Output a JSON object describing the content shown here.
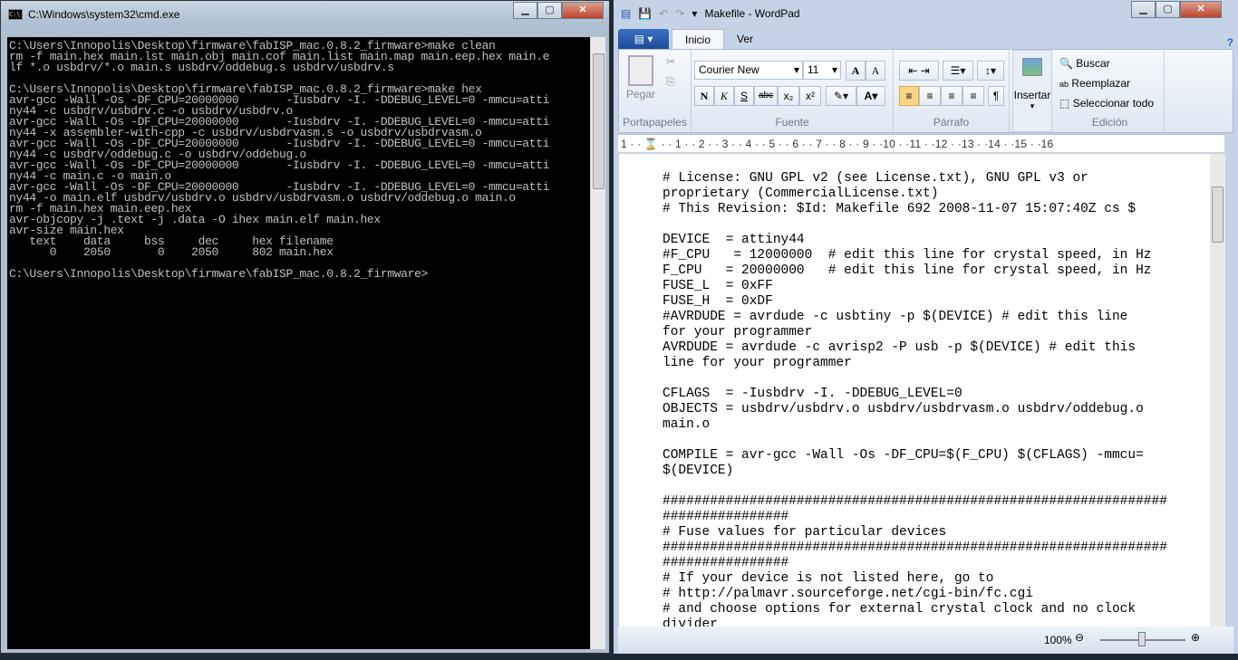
{
  "cmd": {
    "title": "C:\\Windows\\system32\\cmd.exe",
    "icon": "cmd-icon",
    "lines": [
      "C:\\Users\\Innopolis\\Desktop\\firmware\\fabISP_mac.0.8.2_firmware>make clean",
      "rm -f main.hex main.lst main.obj main.cof main.list main.map main.eep.hex main.e",
      "lf *.o usbdrv/*.o main.s usbdrv/oddebug.s usbdrv/usbdrv.s",
      "",
      "C:\\Users\\Innopolis\\Desktop\\firmware\\fabISP_mac.0.8.2_firmware>make hex",
      "avr-gcc -Wall -Os -DF_CPU=20000000       -Iusbdrv -I. -DDEBUG_LEVEL=0 -mmcu=atti",
      "ny44 -c usbdrv/usbdrv.c -o usbdrv/usbdrv.o",
      "avr-gcc -Wall -Os -DF_CPU=20000000       -Iusbdrv -I. -DDEBUG_LEVEL=0 -mmcu=atti",
      "ny44 -x assembler-with-cpp -c usbdrv/usbdrvasm.s -o usbdrv/usbdrvasm.o",
      "avr-gcc -Wall -Os -DF_CPU=20000000       -Iusbdrv -I. -DDEBUG_LEVEL=0 -mmcu=atti",
      "ny44 -c usbdrv/oddebug.c -o usbdrv/oddebug.o",
      "avr-gcc -Wall -Os -DF_CPU=20000000       -Iusbdrv -I. -DDEBUG_LEVEL=0 -mmcu=atti",
      "ny44 -c main.c -o main.o",
      "avr-gcc -Wall -Os -DF_CPU=20000000       -Iusbdrv -I. -DDEBUG_LEVEL=0 -mmcu=atti",
      "ny44 -o main.elf usbdrv/usbdrv.o usbdrv/usbdrvasm.o usbdrv/oddebug.o main.o",
      "rm -f main.hex main.eep.hex",
      "avr-objcopy -j .text -j .data -O ihex main.elf main.hex",
      "avr-size main.hex",
      "   text    data     bss     dec     hex filename",
      "      0    2050       0    2050     802 main.hex",
      "",
      "C:\\Users\\Innopolis\\Desktop\\firmware\\fabISP_mac.0.8.2_firmware>"
    ]
  },
  "wordpad": {
    "title": "Makefile - WordPad",
    "tabs": [
      "Inicio",
      "Ver"
    ],
    "font": "Courier New",
    "size": "11",
    "buttons": {
      "paste": "Pegar",
      "insert": "Insertar",
      "find": "Buscar",
      "replace": "Reemplazar",
      "select_all": "Seleccionar todo",
      "bold": "N",
      "italic": "K",
      "underline": "S",
      "strike": "abc"
    },
    "groups": [
      "Portapapeles",
      "Fuente",
      "Párrafo",
      "Edición"
    ],
    "ruler": "1 · · ⌛ · · 1 · · 2 · · 3 · · 4 · · 5 · · 6 · · 7 · · 8 · · 9 · ·10 · ·11 · ·12 · ·13 · ·14 · ·15 · ·16",
    "document": [
      "# License: GNU GPL v2 (see License.txt), GNU GPL v3 or",
      "proprietary (CommercialLicense.txt)",
      "# This Revision: $Id: Makefile 692 2008-11-07 15:07:40Z cs $",
      "",
      "DEVICE  = attiny44",
      "#F_CPU   = 12000000  # edit this line for crystal speed, in Hz",
      "F_CPU   = 20000000   # edit this line for crystal speed, in Hz",
      "FUSE_L  = 0xFF",
      "FUSE_H  = 0xDF",
      "#AVRDUDE = avrdude -c usbtiny -p $(DEVICE) # edit this line",
      "for your programmer",
      "AVRDUDE = avrdude -c avrisp2 -P usb -p $(DEVICE) # edit this",
      "line for your programmer",
      "",
      "CFLAGS  = -Iusbdrv -I. -DDEBUG_LEVEL=0",
      "OBJECTS = usbdrv/usbdrv.o usbdrv/usbdrvasm.o usbdrv/oddebug.o",
      "main.o",
      "",
      "COMPILE = avr-gcc -Wall -Os -DF_CPU=$(F_CPU) $(CFLAGS) -mmcu=",
      "$(DEVICE)",
      "",
      "################################################################",
      "################",
      "# Fuse values for particular devices",
      "################################################################",
      "################",
      "# If your device is not listed here, go to",
      "# http://palmavr.sourceforge.net/cgi-bin/fc.cgi",
      "# and choose options for external crystal clock and no clock",
      "divider"
    ],
    "zoom": "100%"
  }
}
